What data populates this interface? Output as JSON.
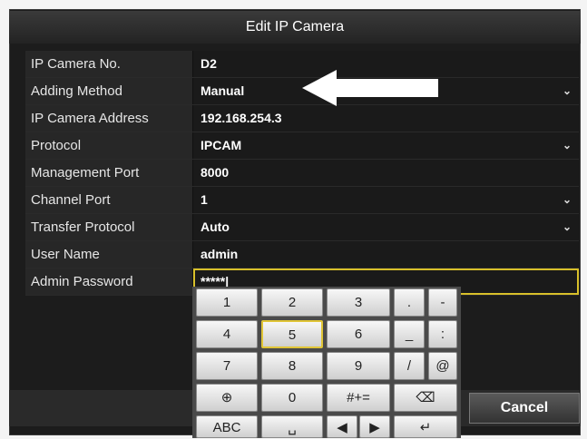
{
  "dialog": {
    "title": "Edit IP Camera"
  },
  "fields": [
    {
      "label": "IP Camera No.",
      "value": "D2",
      "dropdown": false
    },
    {
      "label": "Adding Method",
      "value": "Manual",
      "dropdown": true
    },
    {
      "label": "IP Camera Address",
      "value": "192.168.254.3",
      "dropdown": false
    },
    {
      "label": "Protocol",
      "value": "IPCAM",
      "dropdown": true
    },
    {
      "label": "Management Port",
      "value": "8000",
      "dropdown": false
    },
    {
      "label": "Channel Port",
      "value": "1",
      "dropdown": true
    },
    {
      "label": "Transfer Protocol",
      "value": "Auto",
      "dropdown": true
    },
    {
      "label": "User Name",
      "value": "admin",
      "dropdown": false
    },
    {
      "label": "Admin Password",
      "value": "*****|",
      "dropdown": false
    }
  ],
  "keypad": {
    "keys": [
      "1",
      "2",
      "3",
      ".",
      "-",
      "4",
      "5",
      "6",
      "_",
      ":",
      "7",
      "8",
      "9",
      "/",
      "@",
      "⊕",
      "0",
      "#+=",
      "⌫",
      "ABC",
      "␣",
      "◀",
      "▶",
      "↵"
    ]
  },
  "buttons": {
    "cancel": "Cancel"
  },
  "icons": {
    "chevron": "chevron-down-icon",
    "globe": "globe-icon"
  }
}
